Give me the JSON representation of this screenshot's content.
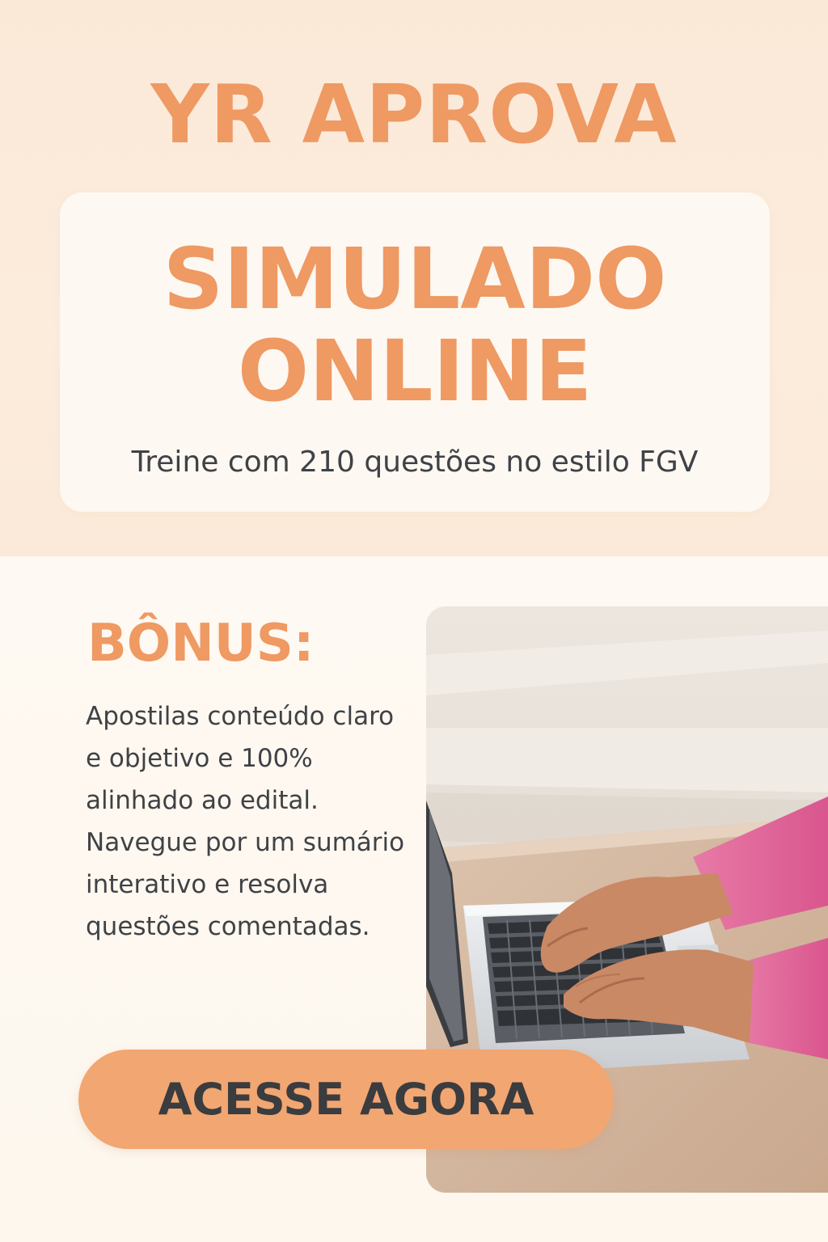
{
  "brand": "YR APROVA",
  "hero": {
    "title_line1": "SIMULADO",
    "title_line2": "ONLINE",
    "subtitle": "Treine com 210 questões no estilo FGV"
  },
  "bonus": {
    "title": "BÔNUS:",
    "text": "Apostilas conteúdo claro e objetivo e 100% alinhado ao edital. Navegue por um sumário interativo e resolva questões comentadas."
  },
  "cta": {
    "label": "ACESSE AGORA"
  },
  "colors": {
    "accent": "#ef9963",
    "button": "#f2a672",
    "text": "#3f4246",
    "background_top": "#fbe9d8",
    "background_bottom": "#fef9f2"
  },
  "image": {
    "subject": "hands-typing-on-laptop"
  }
}
